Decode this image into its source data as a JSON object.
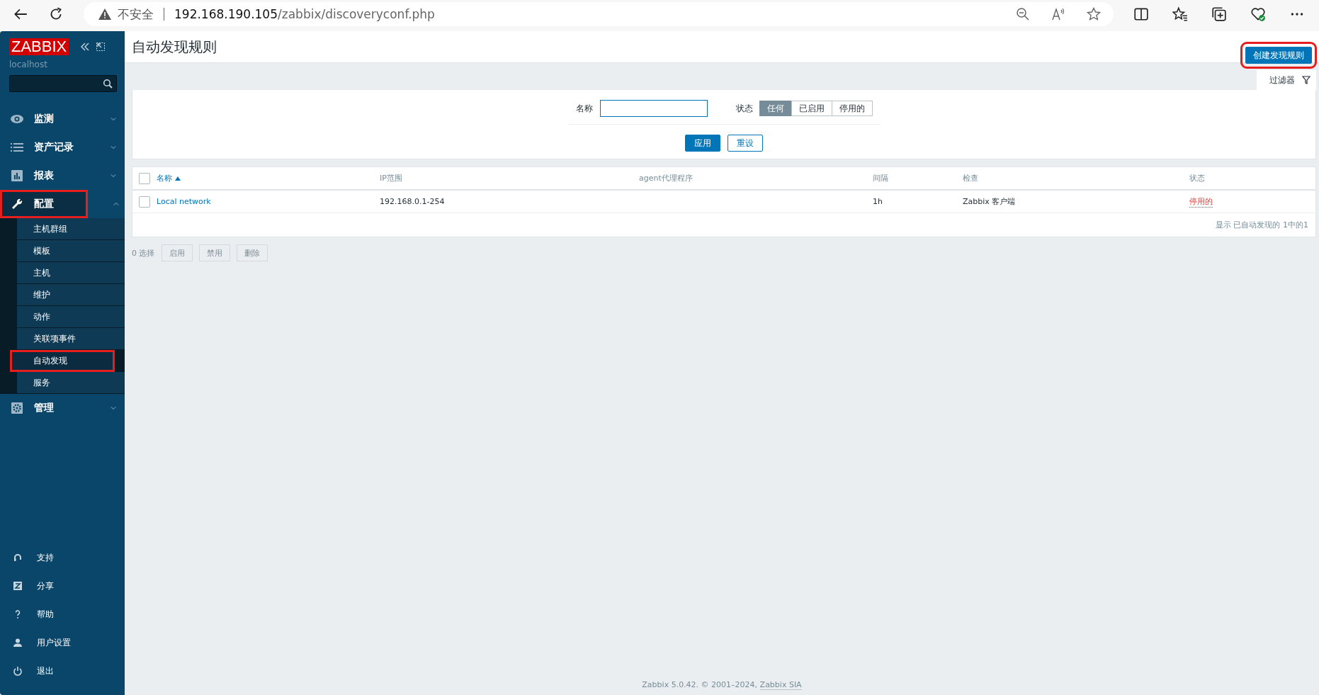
{
  "browser": {
    "security_label": "不安全",
    "url_host": "192.168.190.105",
    "url_path": "/zabbix/discoveryconf.php"
  },
  "sidebar": {
    "logo": "ZABBIX",
    "server": "localhost",
    "menu": [
      {
        "label": "监测",
        "expanded": false,
        "highlighted": false
      },
      {
        "label": "资产记录",
        "expanded": false,
        "highlighted": false
      },
      {
        "label": "报表",
        "expanded": false,
        "highlighted": false
      },
      {
        "label": "配置",
        "expanded": true,
        "highlighted": true,
        "children": [
          {
            "label": "主机群组",
            "selected": false,
            "highlighted": false
          },
          {
            "label": "模板",
            "selected": false,
            "highlighted": false
          },
          {
            "label": "主机",
            "selected": false,
            "highlighted": false
          },
          {
            "label": "维护",
            "selected": false,
            "highlighted": false
          },
          {
            "label": "动作",
            "selected": false,
            "highlighted": false
          },
          {
            "label": "关联项事件",
            "selected": false,
            "highlighted": false
          },
          {
            "label": "自动发现",
            "selected": true,
            "highlighted": true
          },
          {
            "label": "服务",
            "selected": false,
            "highlighted": false
          }
        ]
      },
      {
        "label": "管理",
        "expanded": false,
        "highlighted": false
      }
    ],
    "footer_menu": [
      {
        "label": "支持"
      },
      {
        "label": "分享"
      },
      {
        "label": "帮助"
      },
      {
        "label": "用户设置"
      },
      {
        "label": "退出"
      }
    ]
  },
  "page": {
    "title": "自动发现规则",
    "create_button": {
      "label": "创建发现规则",
      "highlighted": true
    },
    "filter_tab": "过滤器",
    "filter": {
      "name_label": "名称",
      "status_label": "状态",
      "status_options": [
        {
          "label": "任何",
          "selected": true
        },
        {
          "label": "已启用",
          "selected": false
        },
        {
          "label": "停用的",
          "selected": false
        }
      ],
      "apply": "应用",
      "reset": "重设"
    },
    "table": {
      "all_checked": false,
      "columns": [
        {
          "label": "名称",
          "sorted": true
        },
        {
          "label": "IP范围",
          "sorted": false
        },
        {
          "label": "agent代理程序",
          "sorted": false
        },
        {
          "label": "间隔",
          "sorted": false
        },
        {
          "label": "检查",
          "sorted": false
        },
        {
          "label": "状态",
          "sorted": false
        }
      ],
      "rows": [
        {
          "name": "Local network",
          "ip_range": "192.168.0.1-254",
          "interval": "1h",
          "checks": "Zabbix 客户端",
          "status": "停用的",
          "enabled": false,
          "checked": false
        }
      ],
      "summary": "显示 已自动发现的 1中的1"
    },
    "actions": {
      "selected_count": "0 选择",
      "buttons": [
        {
          "label": "启用",
          "disabled": true
        },
        {
          "label": "禁用",
          "disabled": true
        },
        {
          "label": "删除",
          "disabled": true
        }
      ]
    },
    "footer": {
      "text": "Zabbix 5.0.42. © 2001–2024, ",
      "link": "Zabbix SIA"
    }
  }
}
